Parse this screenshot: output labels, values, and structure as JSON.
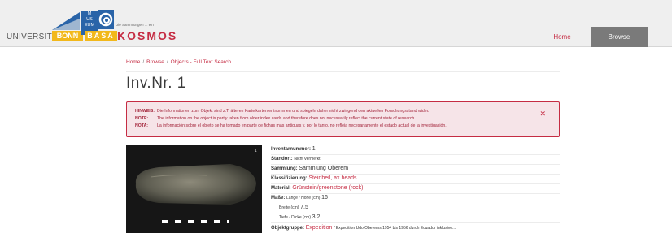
{
  "header": {
    "logo": {
      "university": "UNIVERSITÄT",
      "bonn": "BONN",
      "museum_lines": [
        "M",
        "US",
        "EUM"
      ],
      "basa": "BASA",
      "tagline": "Die Sammlungen ... ein",
      "kosmos": "KOSMOS"
    },
    "nav": {
      "home_label": "Home",
      "browse_label": "Browse"
    },
    "colors": {
      "accent": "#c52c43",
      "nav_active": "#7a7a7a",
      "logo_yellow": "#f2b81b",
      "logo_blue": "#2a64a8"
    }
  },
  "breadcrumb": [
    "Home",
    "Browse",
    "Objects - Full Text Search"
  ],
  "page_title": "Inv.Nr. 1",
  "alert": {
    "rows": [
      {
        "label": "HINWEIS:",
        "text": "Die Informationen zum Objekt sind z.T. älteren Karteikarten entnommen und spiegeln daher nicht zwingend den aktuellen Forschungsstand wider."
      },
      {
        "label": "NOTE:",
        "text": "The information on the object is partly taken from older index cards and therefore does not necessarily reflect the current state of research."
      },
      {
        "label": "NOTA:",
        "text": "La información sobre el objeto se ha tomado en parte de fichas más antiguas y, por lo tanto, no refleja necesariamente el estado actual de la investigación."
      }
    ],
    "close_icon": "close-icon"
  },
  "details": {
    "inventory_label": "Inventarnummer:",
    "inventory_value": "1",
    "location_label": "Standort:",
    "location_value": "Nicht vermerkt",
    "collection_label": "Sammlung:",
    "collection_value": "Sammlung Oberem",
    "classification_label": "Klassifizierung:",
    "classification_value": "Steinbeil, ax heads",
    "material_label": "Material:",
    "material_value": "Grünstein/greenstone (rock)",
    "dimensions_label": "Maße:",
    "length_label": "Länge / Höhe (cm)",
    "length_value": "16",
    "width_label": "Breite (cm)",
    "width_value": "7,5",
    "depth_label": "Tiefe / Dicke (cm)",
    "depth_value": "3,2",
    "group_label": "Objektgruppe:",
    "group_link": "Expedition",
    "group_text": "/ Expedition Udo Oberems 1954 bis 1956 durch Ecuador inklusive..."
  },
  "photo": {
    "corner_mark": "1"
  }
}
